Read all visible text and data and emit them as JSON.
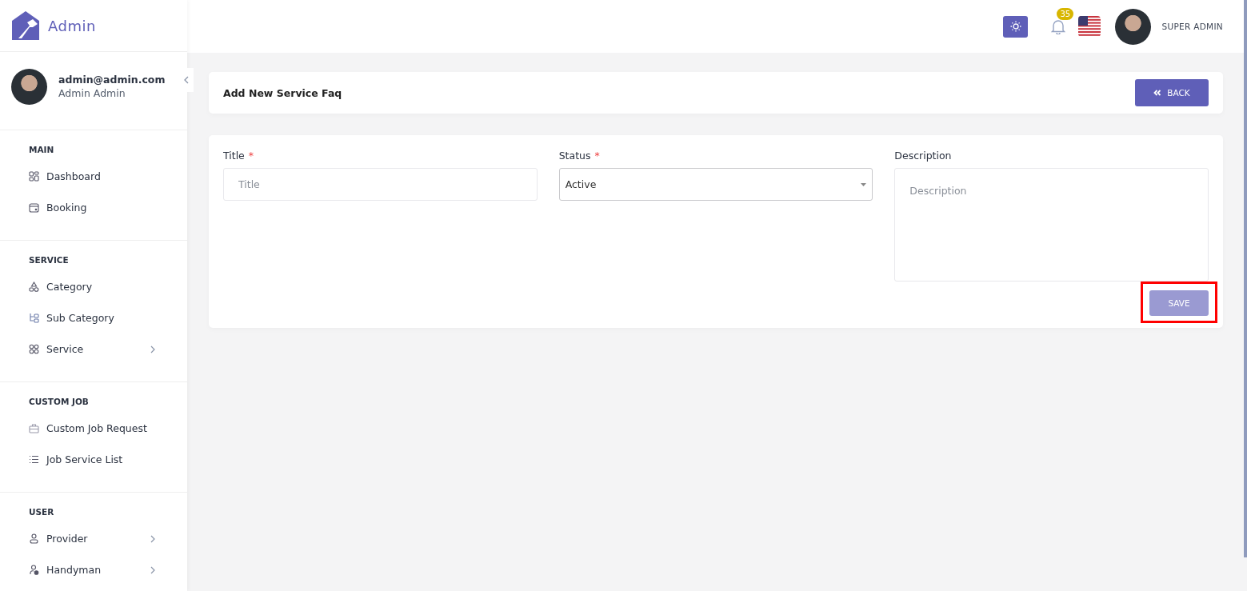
{
  "brand": {
    "name": "Admin"
  },
  "user": {
    "email": "admin@admin.com",
    "name": "Admin Admin"
  },
  "sidebar": {
    "sections": [
      {
        "heading": "MAIN",
        "items": [
          {
            "label": "Dashboard",
            "expandable": false
          },
          {
            "label": "Booking",
            "expandable": false
          }
        ]
      },
      {
        "heading": "SERVICE",
        "items": [
          {
            "label": "Category",
            "expandable": false
          },
          {
            "label": "Sub Category",
            "expandable": false
          },
          {
            "label": "Service",
            "expandable": true
          }
        ]
      },
      {
        "heading": "CUSTOM JOB",
        "items": [
          {
            "label": "Custom Job Request",
            "expandable": false
          },
          {
            "label": "Job Service List",
            "expandable": false
          }
        ]
      },
      {
        "heading": "USER",
        "items": [
          {
            "label": "Provider",
            "expandable": true
          },
          {
            "label": "Handyman",
            "expandable": true
          }
        ]
      }
    ]
  },
  "topbar": {
    "notification_count": "35",
    "account": "SUPER ADMIN"
  },
  "page_header": {
    "title": "Add New Service Faq",
    "back_button": "BACK"
  },
  "form": {
    "fields": [
      {
        "kind": "input",
        "label": "Title",
        "required_mark": "*",
        "placeholder": "Title"
      },
      {
        "kind": "select",
        "label": "Status",
        "required_mark": "*",
        "value": "Active"
      },
      {
        "kind": "textarea",
        "label": "Description",
        "placeholder": "Description"
      }
    ],
    "save_button": {
      "label": "SAVE",
      "disabled": true,
      "highlighted": true
    }
  }
}
